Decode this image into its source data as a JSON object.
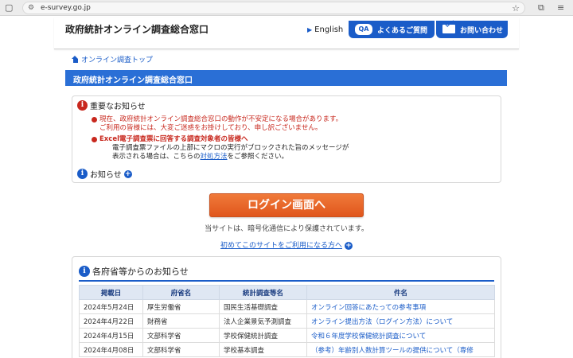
{
  "browser": {
    "url": "e-survey.go.jp"
  },
  "header": {
    "site_title": "政府統計オンライン調査総合窓口",
    "english_label": "English",
    "faq_badge": "QA",
    "faq_label": "よくあるご質問",
    "contact_label": "お問い合わせ"
  },
  "breadcrumb": {
    "label": "オンライン調査トップ"
  },
  "title_bar": {
    "label": "政府統計オンライン調査総合窓口"
  },
  "notices": {
    "heading": "重要なお知らせ",
    "item1_line1": "現在、政府統計オンライン調査総合窓口の動作が不安定になる場合があります。",
    "item1_line2": "ご利用の皆様には、大変ご迷惑をお掛けしており、申し訳ございません。",
    "item2_title": "Excel電子調査票に回答する調査対象者の皆様へ",
    "item2_line1": "電子調査票ファイルの上部にマクロの実行がブロックされた旨のメッセージが",
    "item2_line2_pre": "表示される場合は、こちらの",
    "item2_link": "対処方法",
    "item2_line2_post": "をご参照ください。",
    "oshirase_label": "お知らせ"
  },
  "login": {
    "button_label": "ログイン画面へ",
    "ssl_note": "当サイトは、暗号化通信により保護されています。",
    "first_time_label": "初めてこのサイトをご利用になる方へ"
  },
  "ministry_news": {
    "heading": "各府省等からのお知らせ",
    "columns": [
      "掲載日",
      "府省名",
      "統計調査等名",
      "件名"
    ],
    "rows": [
      {
        "date": "2024年5月24日",
        "ministry": "厚生労働省",
        "survey": "国民生活基礎調査",
        "subject": "オンライン回答にあたっての参考事項"
      },
      {
        "date": "2024年4月22日",
        "ministry": "財務省",
        "survey": "法人企業景気予測調査",
        "subject": "オンライン提出方法（ログイン方法）について"
      },
      {
        "date": "2024年4月15日",
        "ministry": "文部科学省",
        "survey": "学校保健統計調査",
        "subject": "令和６年度学校保健統計調査について"
      },
      {
        "date": "2024年4月08日",
        "ministry": "文部科学省",
        "survey": "学校基本調査",
        "subject": "（参考）年齢別人数計算ツールの提供について（専修"
      }
    ]
  }
}
